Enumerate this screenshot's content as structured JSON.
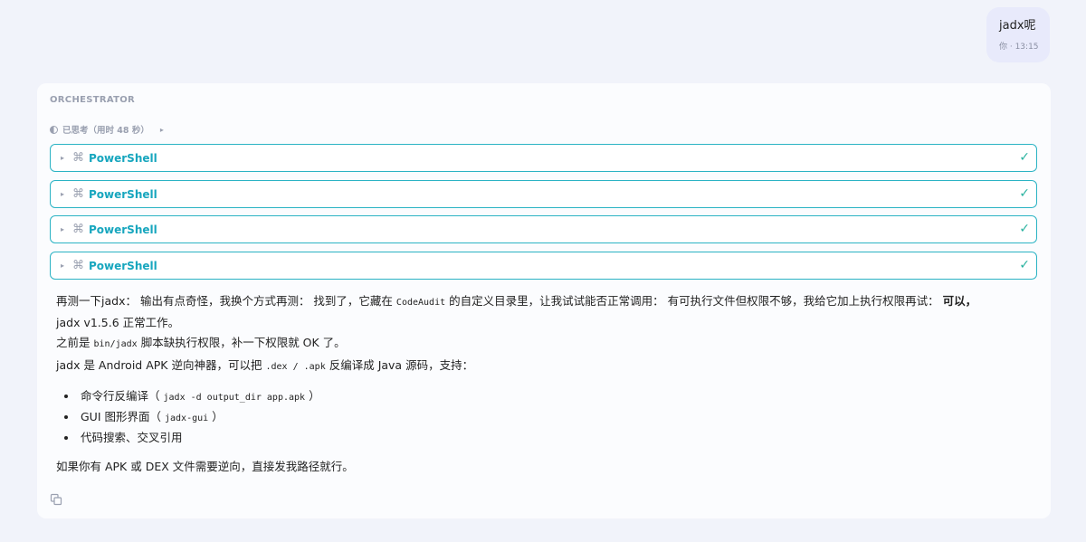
{
  "user_message": {
    "text": "jadx呢",
    "meta": "你 · 13:15"
  },
  "assistant": {
    "agent_label": "ORCHESTRATOR",
    "thinking_label": "已思考（用时 48 秒）",
    "tools": [
      {
        "name": "PowerShell",
        "status_icon": "check-icon"
      },
      {
        "name": "PowerShell",
        "status_icon": "check-icon"
      },
      {
        "name": "PowerShell",
        "status_icon": "check-icon"
      },
      {
        "name": "PowerShell",
        "status_icon": "check-icon"
      }
    ],
    "p1_a": "再测一下jadx： 输出有点奇怪，我换个方式再测： 找到了，它藏在",
    "p1_code": "CodeAudit",
    "p1_b": "的自定义目录里，让我试试能否正常调用： 有可执行文件但权限不够，我给它加上执行权限再试：",
    "p1_bold": "可以，",
    "p1_c": "jadx v1.5.6 正常工作。",
    "p2_a": "之前是",
    "p2_code": "bin/jadx",
    "p2_b": "脚本缺执行权限，补一下权限就 OK 了。",
    "p3_a": "jadx 是 Android APK 逆向神器，可以把",
    "p3_code": ".dex / .apk",
    "p3_b": "反编译成 Java 源码，支持：",
    "list": [
      {
        "text": "命令行反编译（",
        "code": "jadx -d output_dir app.apk",
        "end": "）"
      },
      {
        "text": "GUI 图形界面（",
        "code": "jadx-gui",
        "end": "）"
      },
      {
        "text": "代码搜索、交叉引用",
        "code": "",
        "end": ""
      }
    ],
    "p4": "如果你有 APK 或 DEX 文件需要逆向，直接发我路径就行。"
  },
  "colors": {
    "accent": "#2bb3c4",
    "tool_name": "#17a6be",
    "check": "#2bb3a0",
    "user_bubble": "#e8eafb"
  }
}
